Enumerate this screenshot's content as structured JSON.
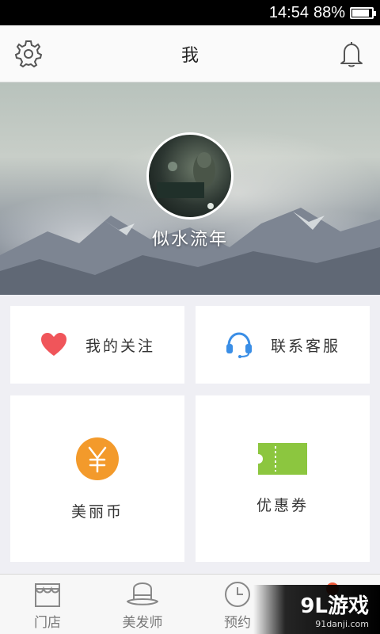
{
  "status_bar": {
    "time": "14:54",
    "battery": "88%",
    "battery_level": 0.88
  },
  "header": {
    "title": "我",
    "left_icon": "gear-icon",
    "right_icon": "bell-icon"
  },
  "profile": {
    "username": "似水流年"
  },
  "menu": {
    "follow": {
      "label": "我的关注",
      "icon": "heart-icon",
      "color": "#f0555a"
    },
    "service": {
      "label": "联系客服",
      "icon": "headset-icon",
      "color": "#3a8ee6"
    },
    "coins": {
      "label": "美丽币",
      "icon": "yen-coin-icon",
      "symbol": "¥",
      "color": "#f39a2b"
    },
    "coupons": {
      "label": "优惠券",
      "icon": "ticket-icon",
      "color": "#8cc63f"
    }
  },
  "tabbar": {
    "items": [
      {
        "label": "门店",
        "icon": "storefront-icon"
      },
      {
        "label": "美发师",
        "icon": "hat-icon"
      },
      {
        "label": "预约",
        "icon": "clock-icon"
      },
      {
        "label": "",
        "icon": "profile-icon"
      }
    ]
  },
  "watermark": {
    "main": "9L游戏",
    "sub": "91danji.com"
  }
}
